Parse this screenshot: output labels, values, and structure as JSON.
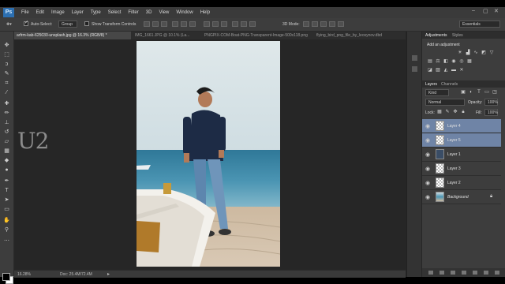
{
  "app": {
    "logo": "Ps"
  },
  "menu": [
    "File",
    "Edit",
    "Image",
    "Layer",
    "Type",
    "Select",
    "Filter",
    "3D",
    "View",
    "Window",
    "Help"
  ],
  "window_controls": {
    "minimize": "–",
    "maximize": "▢",
    "close": "✕"
  },
  "options": {
    "auto_select_label": "Auto-Select:",
    "auto_select_value": "Group",
    "show_transform_label": "Show Transform Controls",
    "mode_label": "3D Mode:",
    "workspace": "Essentials"
  },
  "tabs": [
    {
      "label": "arfrm-kab-625030-unsplash.jpg @ 16.3% (RGB/8) *"
    },
    {
      "label": "IMG_1661.JPG @ 10.1% (La..."
    },
    {
      "label": "PNGPIX-COM-Boat-PNG-Transparent-Image-500x118.png"
    },
    {
      "label": "flying_bird_png_file_by_leosynov.dbd"
    }
  ],
  "watermark": "U2",
  "status": {
    "zoom": "16.28%",
    "doc": "Doc: 25.4M/72.4M"
  },
  "panels": {
    "top_tabs": [
      "Adjustments",
      "Styles"
    ],
    "add_adjustment": "Add an adjustment",
    "layer_tabs": [
      "Layers",
      "Channels"
    ],
    "kind": "Kind",
    "blend_mode": "Normal",
    "opacity_label": "Opacity:",
    "opacity_value": "100%",
    "lock_label": "Lock:",
    "fill_label": "Fill:",
    "fill_value": "100%",
    "layers": [
      {
        "name": "Layer 4",
        "selected": true
      },
      {
        "name": "Layer 5",
        "selected": true
      },
      {
        "name": "Layer 1",
        "selected": false
      },
      {
        "name": "Layer 3",
        "selected": false
      },
      {
        "name": "Layer 2",
        "selected": false
      },
      {
        "name": "Background",
        "selected": false
      }
    ]
  }
}
